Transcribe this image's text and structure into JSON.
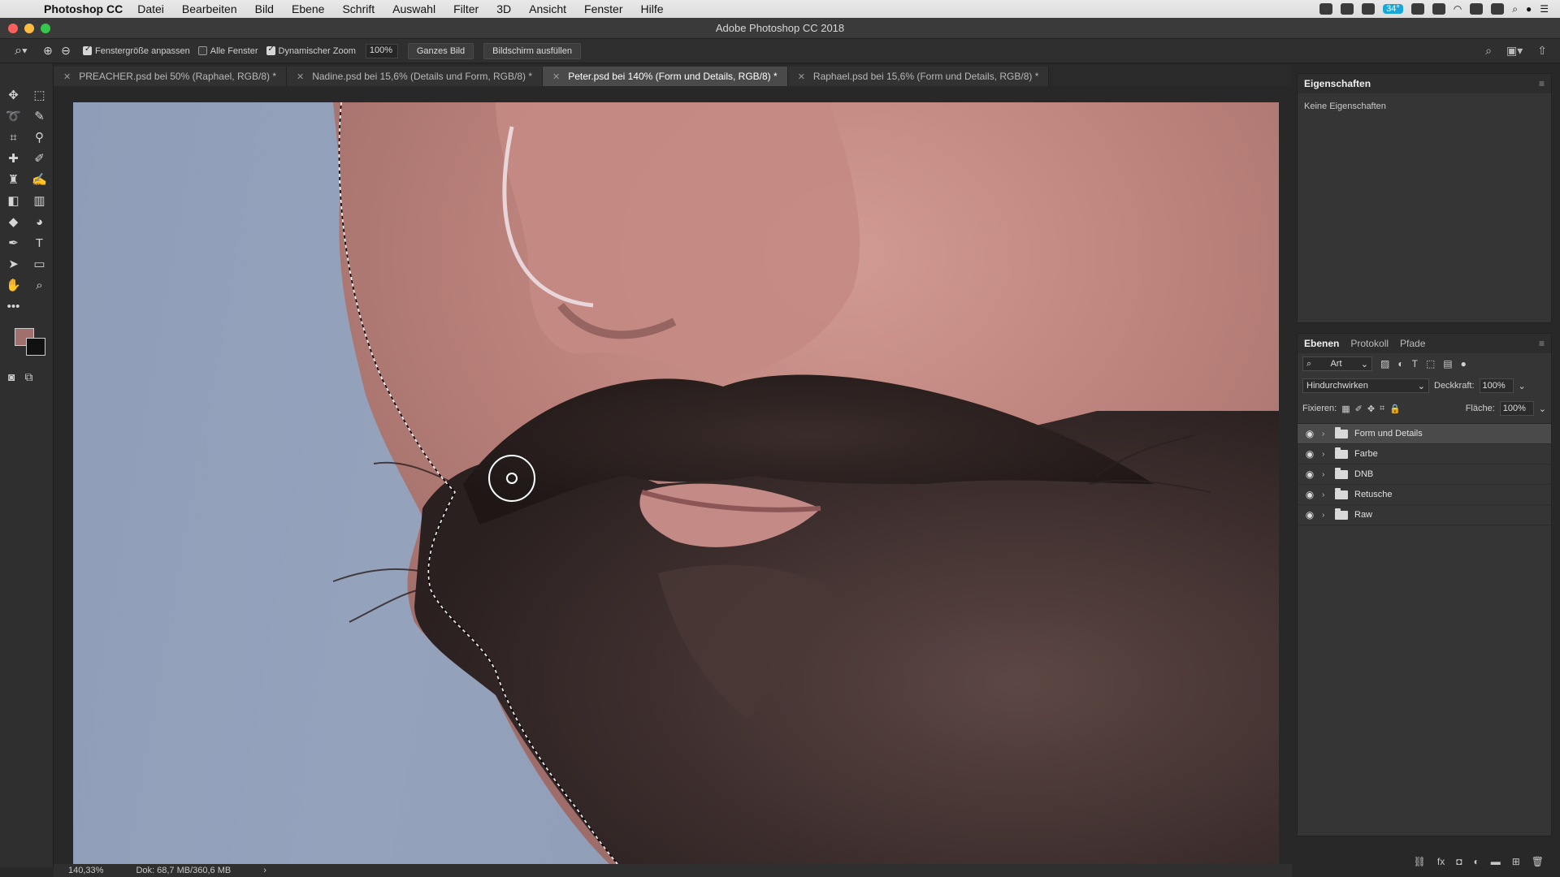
{
  "menubar": {
    "app_name": "Photoshop CC",
    "items": [
      "Datei",
      "Bearbeiten",
      "Bild",
      "Ebene",
      "Schrift",
      "Auswahl",
      "Filter",
      "3D",
      "Ansicht",
      "Fenster",
      "Hilfe"
    ],
    "battery_badge": "34°"
  },
  "window": {
    "title": "Adobe Photoshop CC 2018"
  },
  "options": {
    "fit_window_label": "Fenstergröße anpassen",
    "all_windows_label": "Alle Fenster",
    "dynamic_zoom_label": "Dynamischer Zoom",
    "zoom_value": "100%",
    "fit_screen_button": "Ganzes Bild",
    "fill_screen_button": "Bildschirm ausfüllen"
  },
  "tabs": [
    {
      "label": "PREACHER.psd bei 50% (Raphael, RGB/8) *",
      "active": false
    },
    {
      "label": "Nadine.psd bei 15,6% (Details und Form, RGB/8) *",
      "active": false
    },
    {
      "label": "Peter.psd bei 140% (Form und Details, RGB/8) *",
      "active": true
    },
    {
      "label": "Raphael.psd bei 15,6% (Form und Details, RGB/8) *",
      "active": false
    }
  ],
  "status": {
    "zoom": "140,33%",
    "doc": "Dok: 68,7 MB/360,6 MB",
    "arrow": "›"
  },
  "properties": {
    "title": "Eigenschaften",
    "empty": "Keine Eigenschaften"
  },
  "layers_panel": {
    "tabs": [
      "Ebenen",
      "Protokoll",
      "Pfade"
    ],
    "filter_label": "Art",
    "blend_mode": "Hindurchwirken",
    "opacity_label": "Deckkraft:",
    "opacity_value": "100%",
    "lock_label": "Fixieren:",
    "fill_label": "Fläche:",
    "fill_value": "100%",
    "layers": [
      {
        "name": "Form und Details",
        "selected": true
      },
      {
        "name": "Farbe",
        "selected": false
      },
      {
        "name": "DNB",
        "selected": false
      },
      {
        "name": "Retusche",
        "selected": false
      },
      {
        "name": "Raw",
        "selected": false
      }
    ]
  },
  "colors": {
    "foreground": "#a06f6e",
    "background": "#111111",
    "accent": "#18a7d8"
  }
}
